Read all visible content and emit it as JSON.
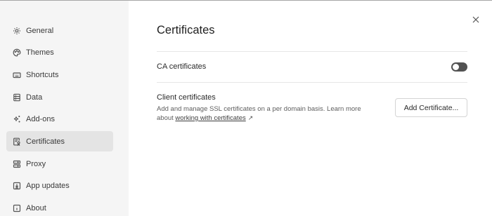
{
  "sidebar": {
    "items": [
      {
        "label": "General",
        "icon": "gear-icon",
        "active": false
      },
      {
        "label": "Themes",
        "icon": "palette-icon",
        "active": false
      },
      {
        "label": "Shortcuts",
        "icon": "keyboard-icon",
        "active": false
      },
      {
        "label": "Data",
        "icon": "database-icon",
        "active": false
      },
      {
        "label": "Add-ons",
        "icon": "sparkle-icon",
        "active": false
      },
      {
        "label": "Certificates",
        "icon": "certificate-icon",
        "active": true
      },
      {
        "label": "Proxy",
        "icon": "proxy-icon",
        "active": false
      },
      {
        "label": "App updates",
        "icon": "download-icon",
        "active": false
      },
      {
        "label": "About",
        "icon": "info-icon",
        "active": false
      }
    ]
  },
  "main": {
    "title": "Certificates",
    "ca_certificates": {
      "label": "CA certificates",
      "enabled": false
    },
    "client_certificates": {
      "label": "Client certificates",
      "description": "Add and manage SSL certificates on a per domain basis. Learn more about",
      "link_text": "working with certificates",
      "link_icon": "external-link-icon",
      "button_label": "Add Certificate..."
    }
  },
  "colors": {
    "sidebar_bg": "#f5f5f5",
    "active_item_bg": "#e4e4e4",
    "toggle_off": "#525252"
  }
}
